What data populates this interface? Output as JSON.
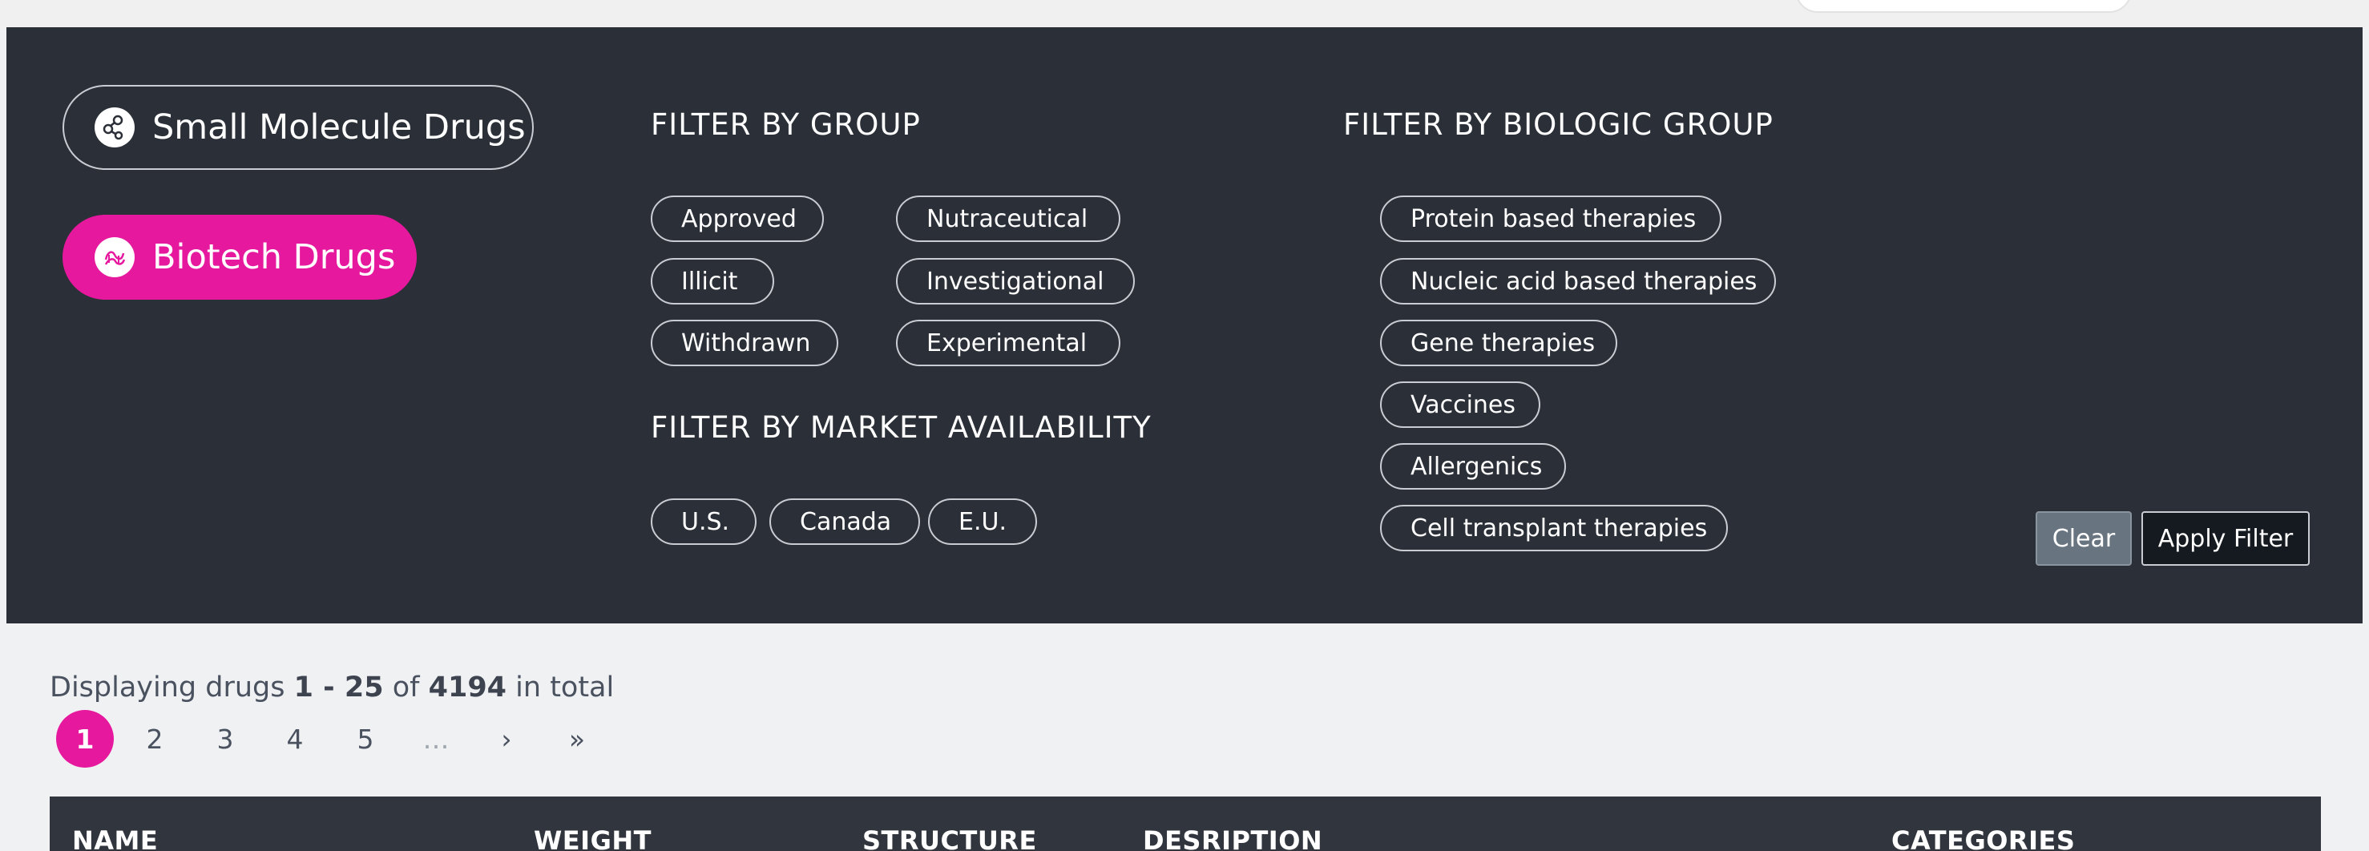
{
  "type_buttons": {
    "small_molecule": "Small Molecule Drugs",
    "biotech": "Biotech Drugs"
  },
  "filter_by_group": {
    "title": "FILTER BY GROUP",
    "chips": [
      "Approved",
      "Nutraceutical",
      "Illicit",
      "Investigational",
      "Withdrawn",
      "Experimental"
    ]
  },
  "filter_by_market": {
    "title": "FILTER BY MARKET AVAILABILITY",
    "chips": [
      "U.S.",
      "Canada",
      "E.U."
    ]
  },
  "filter_by_biologic": {
    "title": "FILTER BY BIOLOGIC GROUP",
    "chips": [
      "Protein based therapies",
      "Nucleic acid based therapies",
      "Gene therapies",
      "Vaccines",
      "Allergenics",
      "Cell transplant therapies"
    ]
  },
  "actions": {
    "clear": "Clear",
    "apply": "Apply Filter"
  },
  "results": {
    "prefix": "Displaying drugs ",
    "range": "1 - 25",
    "of": " of ",
    "total": "4194",
    "suffix": " in total"
  },
  "pagination": {
    "pages": [
      "1",
      "2",
      "3",
      "4",
      "5"
    ],
    "ellipsis": "…",
    "next": "›",
    "last": "»",
    "active": "1"
  },
  "table": {
    "headers": [
      "NAME",
      "WEIGHT",
      "STRUCTURE",
      "DESRIPTION",
      "CATEGORIES"
    ]
  },
  "colors": {
    "panel": "#2b2f37",
    "accent": "#e6199e"
  }
}
